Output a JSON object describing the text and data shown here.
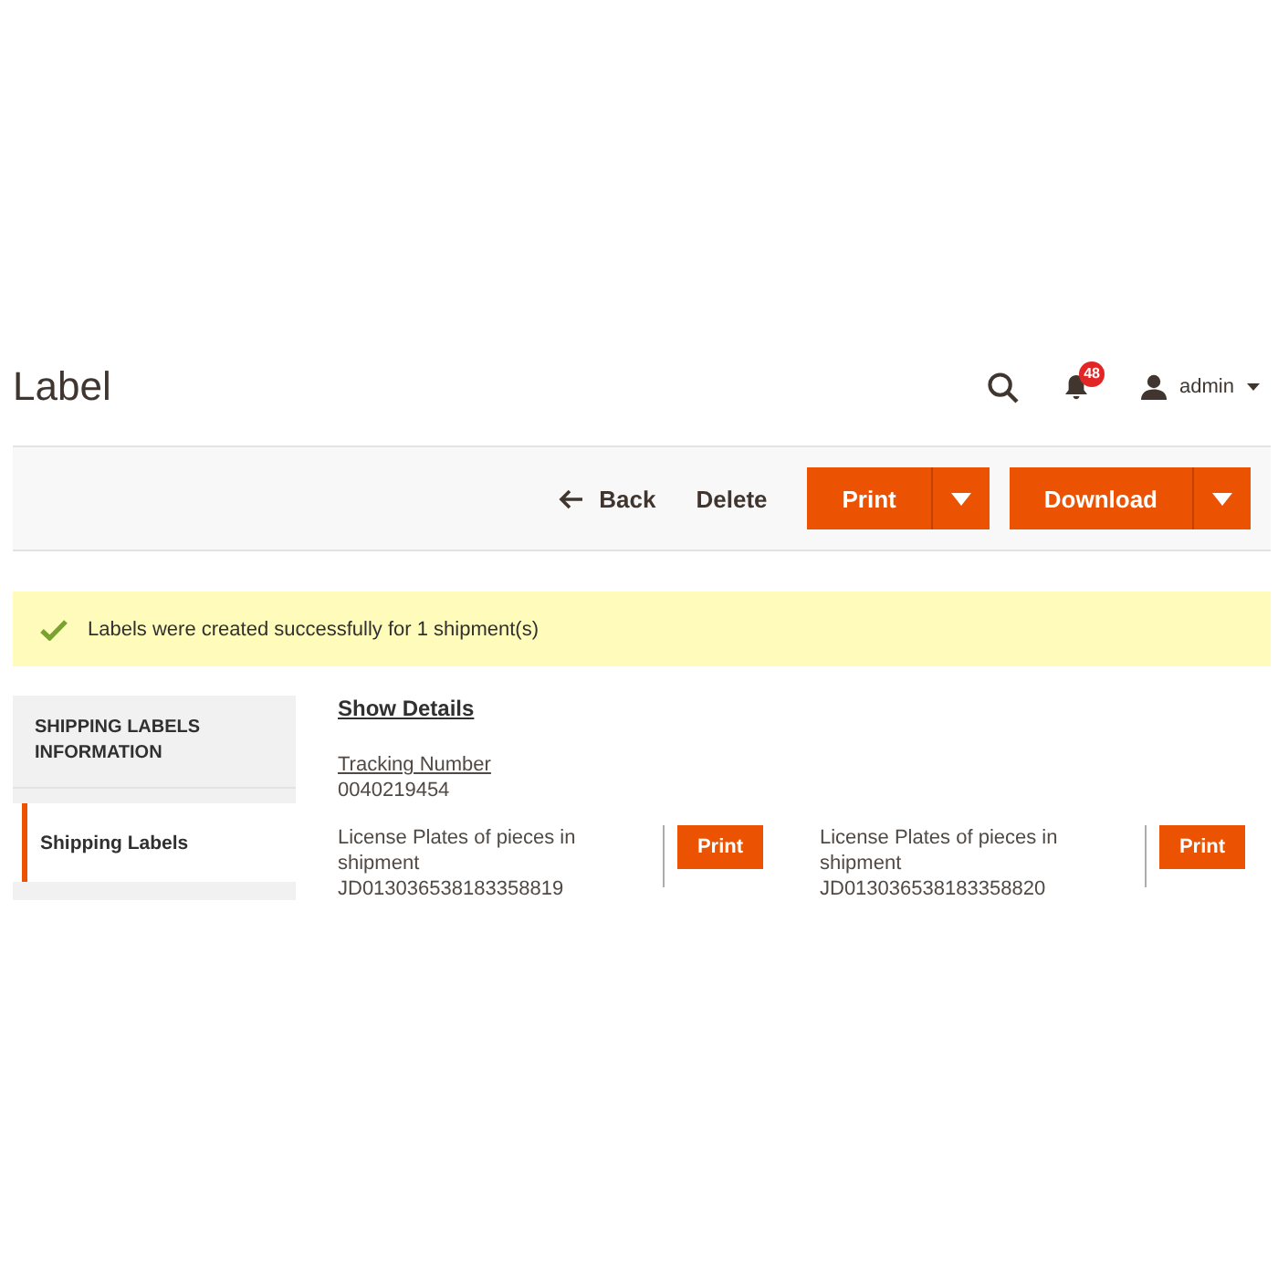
{
  "page_title": "Label",
  "header": {
    "notifications": {
      "count": "48"
    },
    "user": {
      "name": "admin"
    }
  },
  "actions": [
    {
      "kind": "back",
      "label": "Back"
    },
    {
      "kind": "link",
      "label": "Delete"
    },
    {
      "kind": "split",
      "label": "Print"
    },
    {
      "kind": "split",
      "label": "Download"
    }
  ],
  "message": {
    "kind": "success",
    "text": "Labels were created successfully for 1 shipment(s)"
  },
  "sidebar": {
    "title": "SHIPPING LABELS INFORMATION",
    "items": [
      {
        "label": "Shipping Labels",
        "selected": true
      }
    ]
  },
  "content": {
    "toggle": "Show Details",
    "tracking": {
      "label": "Tracking Number",
      "value": "0040219454"
    },
    "packages": [
      {
        "label": "License Plates of pieces in shipment",
        "value": "JD013036538183358819",
        "button": "Print"
      },
      {
        "label": "License Plates of pieces in shipment",
        "value": "JD013036538183358820",
        "button": "Print"
      }
    ]
  }
}
